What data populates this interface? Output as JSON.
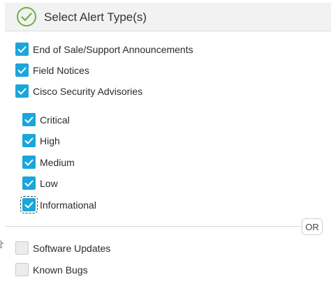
{
  "header": {
    "title": "Select Alert Type(s)",
    "icon": "check-circle-icon",
    "icon_color": "#6cb33f"
  },
  "colors": {
    "checked": "#1aa6da",
    "unchecked": "#ececec"
  },
  "alert_types": [
    {
      "label": "End of Sale/Support Announcements",
      "checked": true
    },
    {
      "label": "Field Notices",
      "checked": true
    },
    {
      "label": "Cisco Security Advisories",
      "checked": true
    }
  ],
  "severities": [
    {
      "label": "Critical",
      "checked": true
    },
    {
      "label": "High",
      "checked": true
    },
    {
      "label": "Medium",
      "checked": true
    },
    {
      "label": "Low",
      "checked": true
    },
    {
      "label": "Informational",
      "checked": true,
      "focused": true
    }
  ],
  "separator": {
    "label": "OR"
  },
  "other_types": [
    {
      "label": "Software Updates",
      "checked": false
    },
    {
      "label": "Known Bugs",
      "checked": false
    }
  ]
}
